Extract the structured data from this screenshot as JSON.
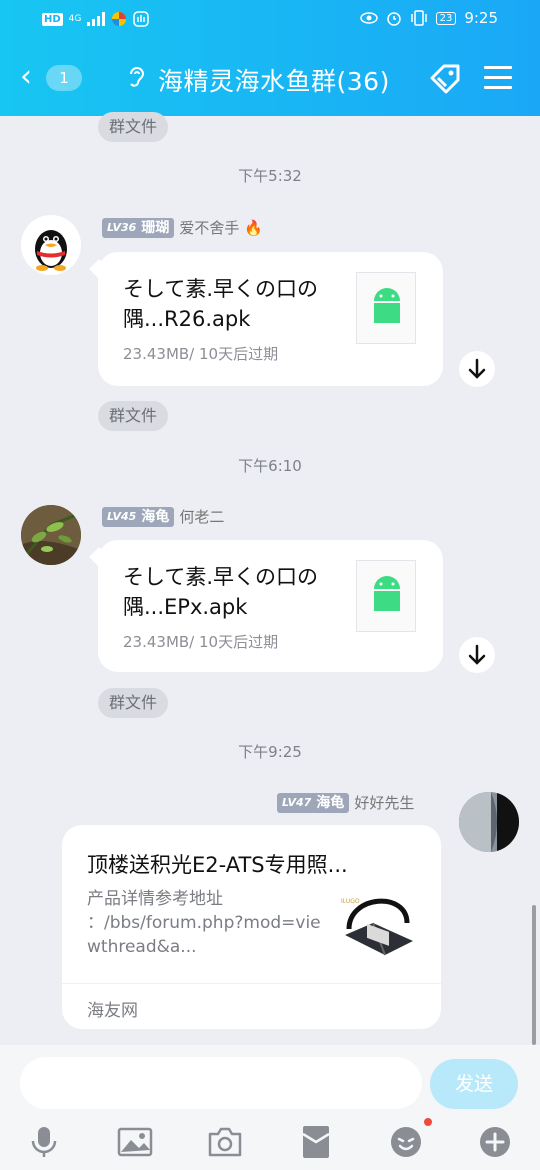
{
  "status_bar": {
    "time": "9:25",
    "battery": "23",
    "network": "4G"
  },
  "header": {
    "back_count": "1",
    "title": "海精灵海水鱼群(36)"
  },
  "messages": [
    {
      "type": "pill",
      "label": "群文件"
    },
    {
      "type": "time",
      "text": "下午5:32"
    },
    {
      "type": "file",
      "sender": {
        "level": "LV36",
        "rank": "珊瑚",
        "name": "爱不舍手",
        "emoji": "🔥"
      },
      "file_title": "そして素.早くの口の隅...R26.apk",
      "file_meta": "23.43MB/ 10天后过期"
    },
    {
      "type": "pill",
      "label": "群文件"
    },
    {
      "type": "time",
      "text": "下午6:10"
    },
    {
      "type": "file",
      "sender": {
        "level": "LV45",
        "rank": "海龟",
        "name": "何老二"
      },
      "file_title": "そして素.早くの口の隅...EPx.apk",
      "file_meta": "23.43MB/ 10天后过期"
    },
    {
      "type": "pill",
      "label": "群文件"
    },
    {
      "type": "time",
      "text": "下午9:25"
    },
    {
      "type": "link",
      "sender": {
        "level": "LV47",
        "rank": "海龟",
        "name": "好好先生"
      },
      "link_title": "顶楼送积光E2-ATS专用照...",
      "link_desc": "产品详情参考地址\n：/bbs/forum.php?mod=viewthread&a...",
      "link_source": "海友网"
    }
  ],
  "input": {
    "placeholder": "",
    "send_label": "发送"
  },
  "toolbar": [
    "mic-icon",
    "image-icon",
    "camera-icon",
    "red-packet-icon",
    "emoji-icon",
    "plus-icon"
  ],
  "colors": {
    "header_start": "#18c6f2",
    "header_end": "#1aa8f6",
    "send_button": "#b8e9fb",
    "chat_bg": "#eceef3"
  }
}
